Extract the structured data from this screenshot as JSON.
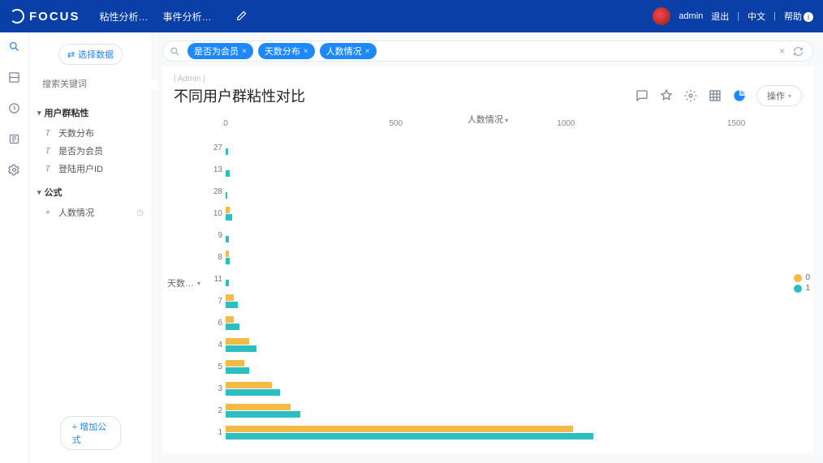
{
  "brand": "FOCUS",
  "top_nav": {
    "item1": "粘性分析…",
    "item2": "事件分析…"
  },
  "user": {
    "name": "admin",
    "logout": "退出",
    "lang": "中文",
    "help": "帮助"
  },
  "sidebar": {
    "select_data_btn": "选择数据",
    "search_placeholder": "搜索关键词",
    "group1_title": "用户群粘性",
    "fields": {
      "f1": "天数分布",
      "f2": "是否为会员",
      "f3": "登陆用户ID"
    },
    "group2_title": "公式",
    "formula1": "人数情况",
    "add_formula_btn": "增加公式"
  },
  "query": {
    "pills": {
      "p1": "是否为会员",
      "p2": "天数分布",
      "p3": "人数情况"
    }
  },
  "title": {
    "crumb": "| Admin |",
    "text": "不同用户群粘性对比",
    "ops_btn": "操作"
  },
  "chart_data": {
    "type": "bar",
    "orientation": "horizontal",
    "xlabel": "人数情况",
    "ylabel": "天数…",
    "xlim": [
      0,
      1550
    ],
    "x_ticks": [
      0,
      500,
      1000,
      1500
    ],
    "categories": [
      "27",
      "13",
      "28",
      "10",
      "9",
      "8",
      "11",
      "7",
      "6",
      "4",
      "5",
      "3",
      "2",
      "1"
    ],
    "series": [
      {
        "name": "0",
        "color": "#f5b945",
        "values": [
          0,
          0,
          0,
          12,
          0,
          10,
          0,
          25,
          25,
          70,
          55,
          135,
          190,
          1020
        ]
      },
      {
        "name": "1",
        "color": "#2bbfc4",
        "values": [
          8,
          12,
          5,
          20,
          10,
          12,
          10,
          35,
          40,
          90,
          70,
          160,
          220,
          1080
        ]
      }
    ],
    "legend": {
      "s0": "0",
      "s1": "1"
    }
  }
}
